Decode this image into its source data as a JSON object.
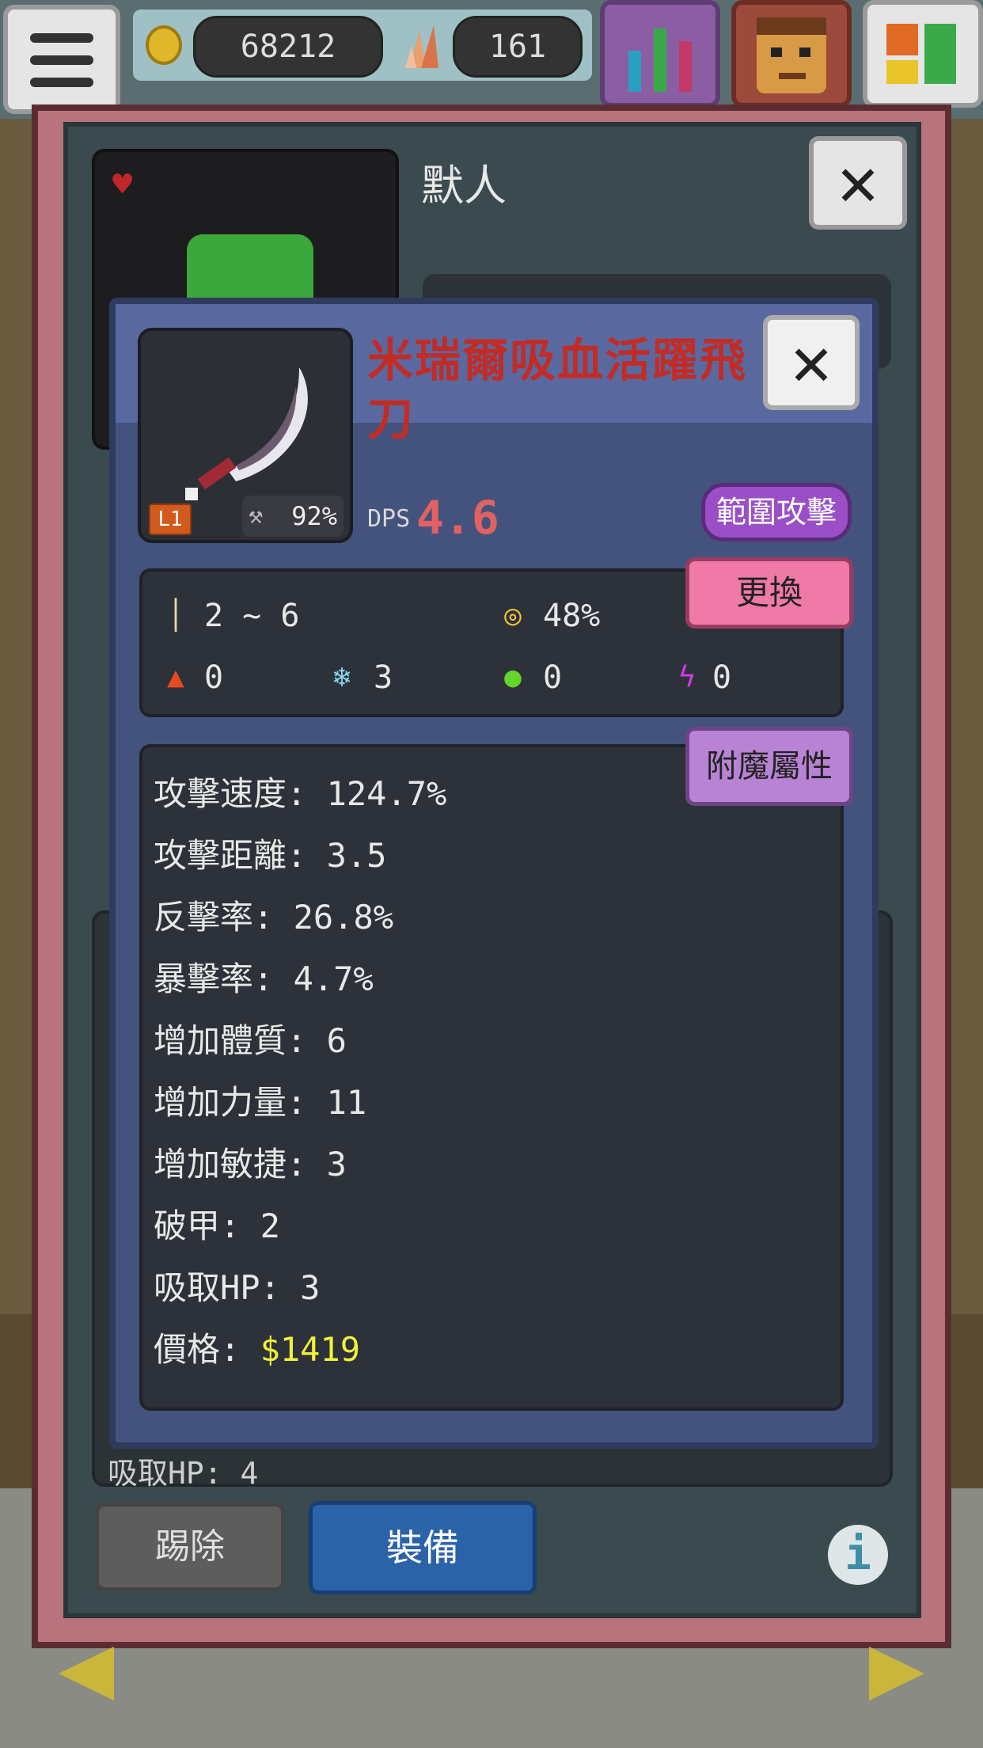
{
  "topbar": {
    "coins": "68212",
    "crystals": "161"
  },
  "hero_panel": {
    "name": "默人",
    "partial_stat": "吸取HP: 4",
    "kick_label": "踢除",
    "equip_label": "裝備"
  },
  "item": {
    "name": "米瑞爾吸血活躍飛刀",
    "level": "L1",
    "durability": "92%",
    "dps_label": "DPS",
    "dps_value": "4.6",
    "tag_aoe": "範圍攻擊",
    "swap_label": "更換",
    "enchant_label": "附魔屬性",
    "base": {
      "damage": "2 ~ 6",
      "accuracy": "48%",
      "fire": "0",
      "ice": "3",
      "poison": "0",
      "lightning": "0"
    },
    "attributes": [
      {
        "label": "攻擊速度:",
        "value": "124.7%"
      },
      {
        "label": "攻擊距離:",
        "value": "3.5"
      },
      {
        "label": "反擊率:",
        "value": "26.8%"
      },
      {
        "label": "暴擊率:",
        "value": "4.7%"
      },
      {
        "label": "增加體質:",
        "value": "6"
      },
      {
        "label": "增加力量:",
        "value": "11"
      },
      {
        "label": "增加敏捷:",
        "value": "3"
      },
      {
        "label": "破甲:",
        "value": "2"
      },
      {
        "label": "吸取HP:",
        "value": "3"
      }
    ],
    "price_label": "價格:",
    "price_value": "$1419"
  },
  "colors": {
    "item_name": "#c22c26",
    "dps": "#e06262",
    "price": "#f1f13a",
    "dialog_bg": "#44537e",
    "swap_button": "#f07aa7",
    "enchant_button": "#b883d4",
    "aoe_tag": "#9a4fc6",
    "equip_button": "#2a63a8"
  },
  "icons": [
    "menu-icon",
    "coin-icon",
    "crystal-icon",
    "stats-icon",
    "hero-icon",
    "layout-icon",
    "heart-icon",
    "close-icon",
    "hammer-icon",
    "sword-icon",
    "target-icon",
    "fire-icon",
    "snowflake-icon",
    "poison-icon",
    "lightning-icon",
    "info-icon",
    "arrow-left-icon",
    "arrow-right-icon"
  ]
}
